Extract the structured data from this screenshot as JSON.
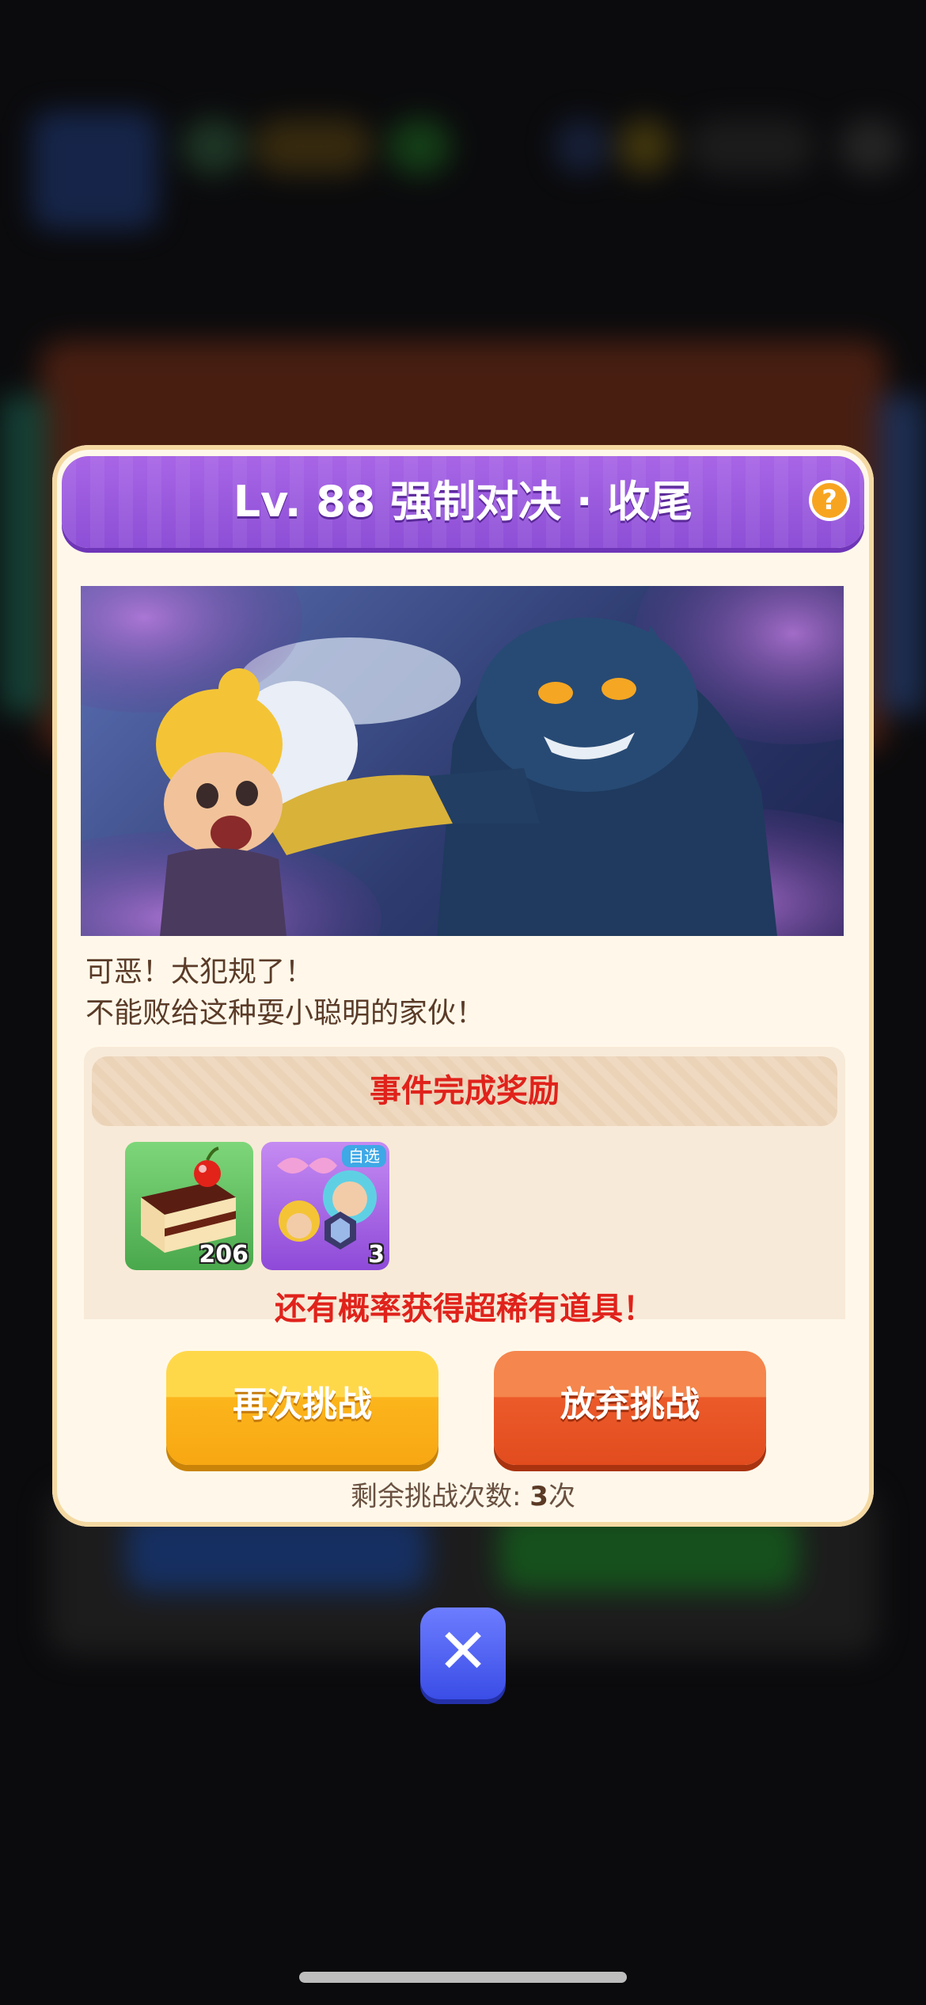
{
  "dialog": {
    "title": "Lv. 88 强制对决 · 收尾",
    "help_icon": "question-mark-icon",
    "story_lines": [
      "可恶！太犯规了！",
      "不能败给这种耍小聪明的家伙！"
    ]
  },
  "rewards": {
    "header": "事件完成奖励",
    "items": [
      {
        "name": "cake",
        "count": "206",
        "tag": ""
      },
      {
        "name": "hero-pack",
        "count": "3",
        "tag": "自选"
      }
    ],
    "rare_text": "还有概率获得超稀有道具！"
  },
  "buttons": {
    "retry": "再次挑战",
    "give_up": "放弃挑战"
  },
  "remaining": {
    "label": "剩余挑战次数: ",
    "count": "3",
    "unit": "次"
  },
  "close_icon": "close-x-icon",
  "colors": {
    "title_purple": "#9d5ae0",
    "reward_red": "#e0221b",
    "retry_yellow": "#fcb51c",
    "giveup_orange": "#ec5a2a",
    "close_blue": "#4a5cf0"
  }
}
